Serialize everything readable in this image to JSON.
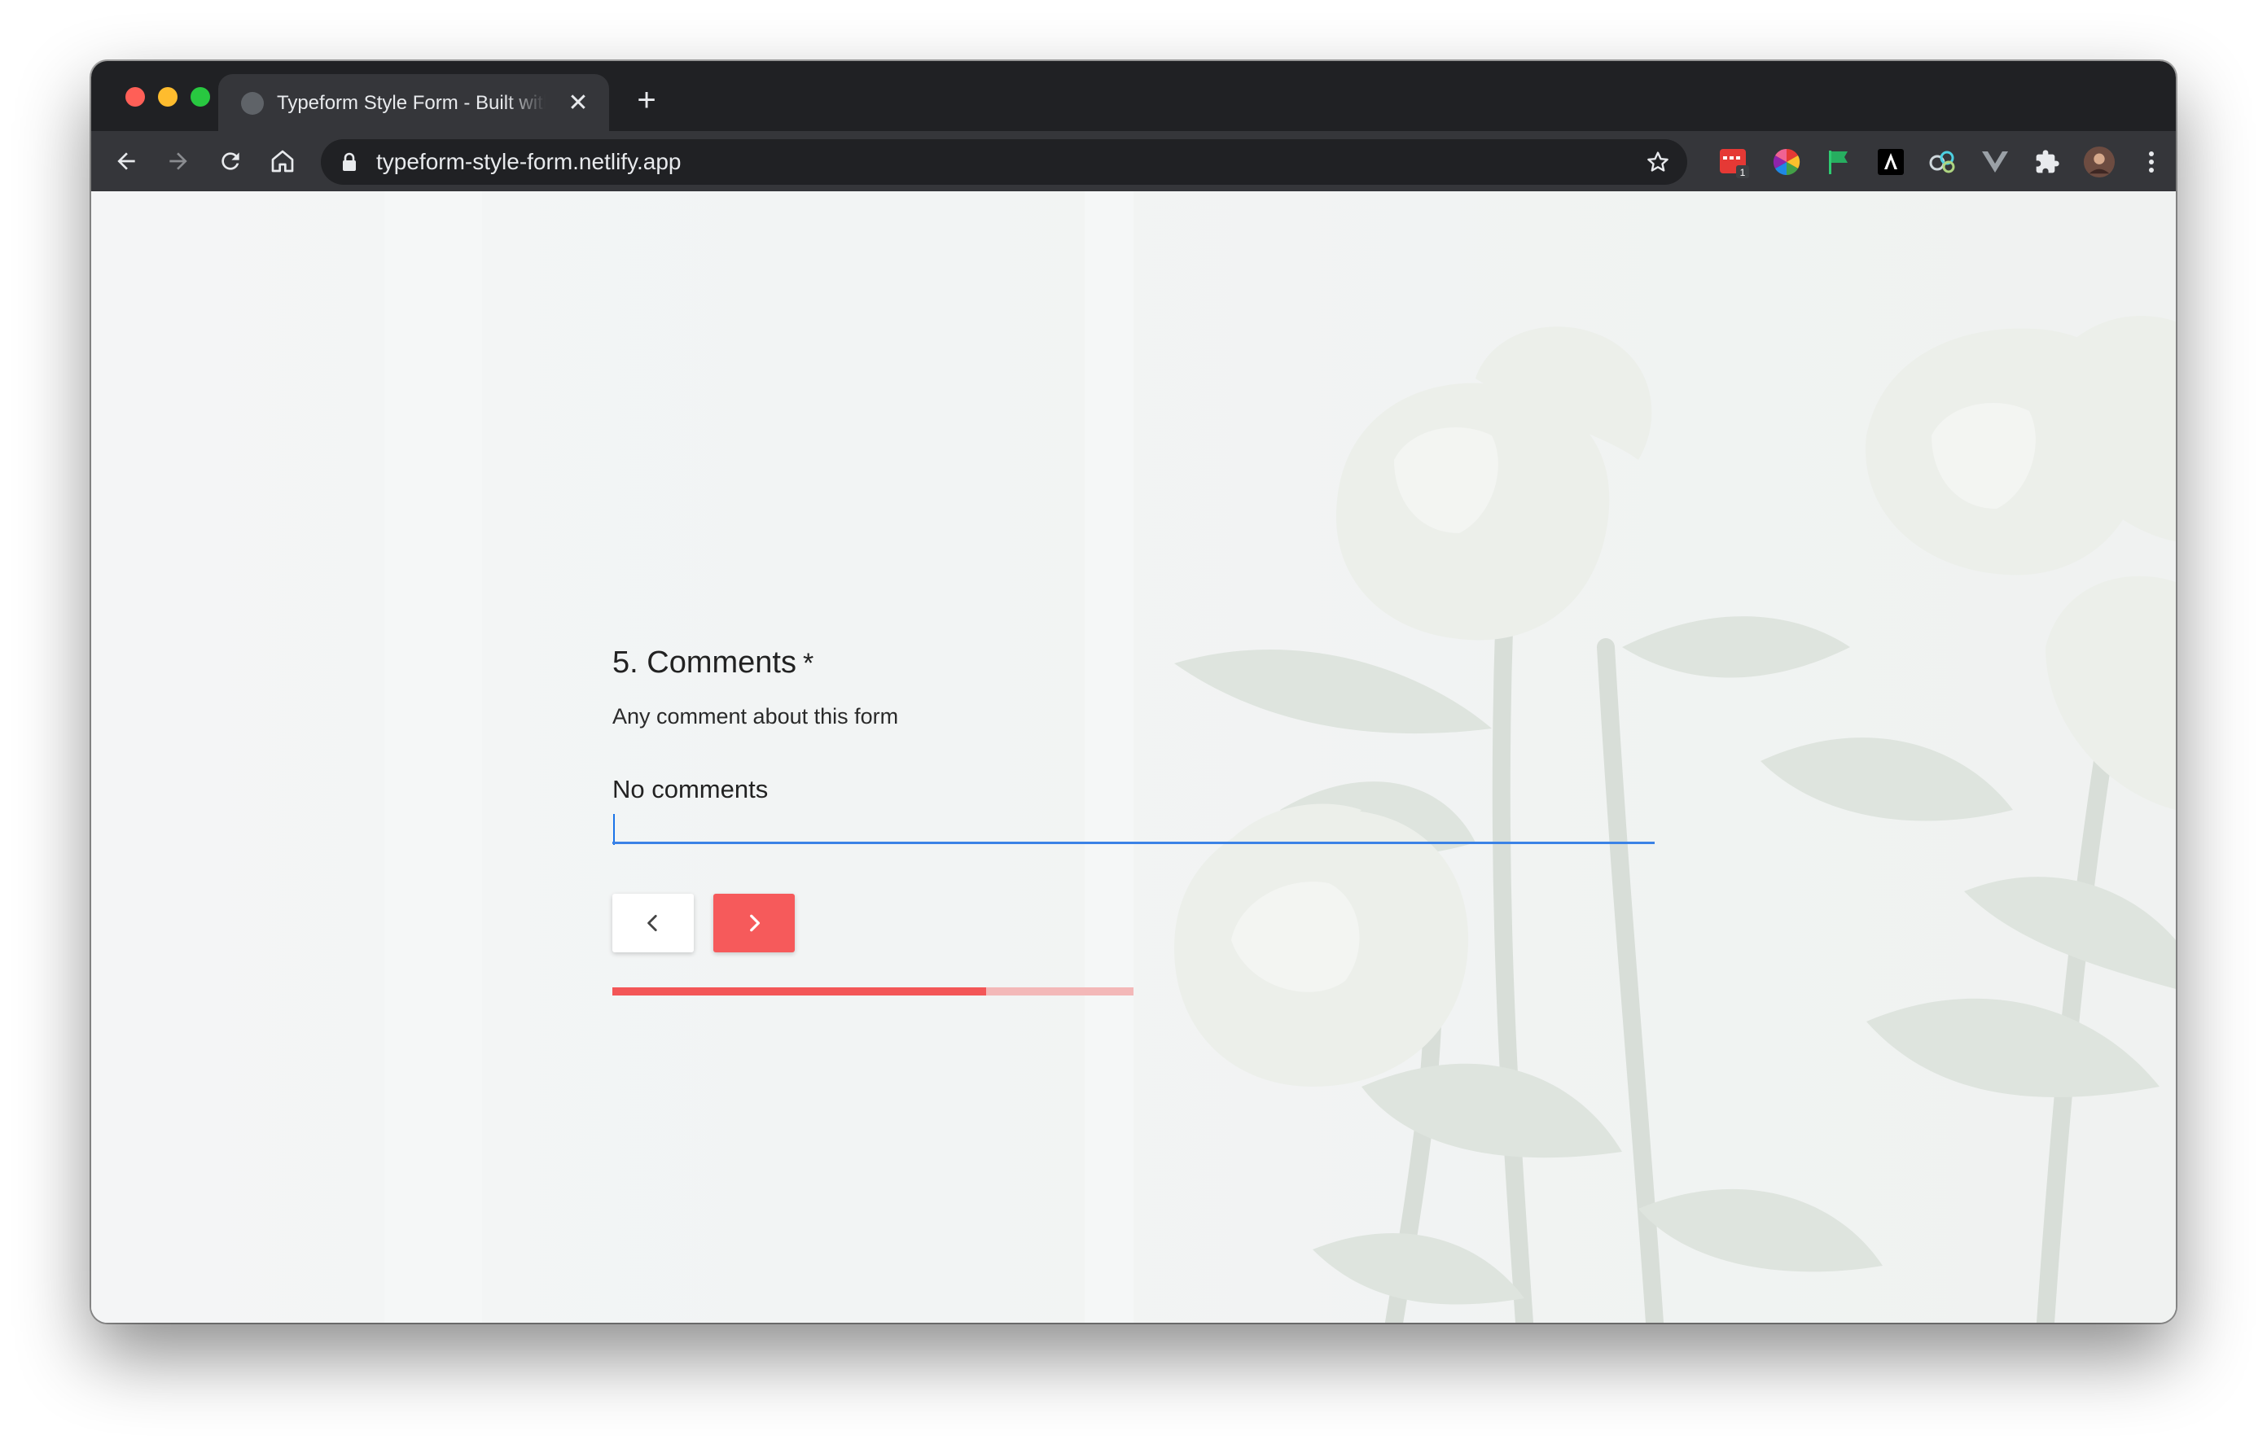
{
  "browser": {
    "tab_title": "Typeform Style Form - Built with",
    "close_label": "✕",
    "new_tab_label": "+",
    "url": "typeform-style-form.netlify.app",
    "extension_badge": "1",
    "colors": {
      "close": "#ff5f57",
      "minimize": "#febc2e",
      "maximize": "#28c840"
    },
    "icons": [
      "back-arrow-icon",
      "forward-arrow-icon",
      "reload-icon",
      "home-icon",
      "lock-icon",
      "bookmark-star-icon",
      "puzzle-icon",
      "kebab-menu-icon"
    ]
  },
  "form": {
    "question_number_title": "5. Comments",
    "required_mark": "*",
    "description": "Any comment about this form",
    "answer_value": "No comments",
    "progress": 0.717,
    "colors": {
      "accent": "#f65a5b",
      "input_line": "#3b82e6",
      "progress_fill": "#f35657",
      "progress_track": "#f3b8b8"
    }
  }
}
